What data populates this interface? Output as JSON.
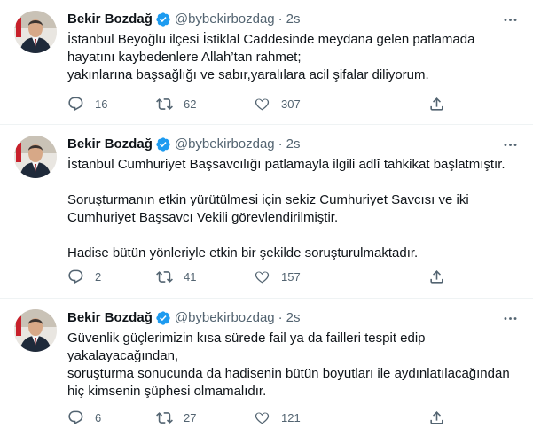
{
  "colors": {
    "text_primary": "#0f1419",
    "text_secondary": "#536471",
    "verified_blue": "#1d9bf0",
    "divider": "#eff3f4"
  },
  "tweets": [
    {
      "author": "Bekir Bozdağ",
      "handle": "@bybekirbozdag",
      "separator": "·",
      "time": "2s",
      "text": "İstanbul Beyoğlu ilçesi İstiklal Caddesinde meydana gelen patlamada\nhayatını kaybedenlere Allah’tan rahmet;\nyakınlarına başsağlığı ve sabır,yaralılara acil şifalar diliyorum.",
      "replies": "16",
      "retweets": "62",
      "likes": "307"
    },
    {
      "author": "Bekir Bozdağ",
      "handle": "@bybekirbozdag",
      "separator": "·",
      "time": "2s",
      "text": "İstanbul Cumhuriyet Başsavcılığı patlamayla ilgili adlî tahkikat başlatmıştır.\n\nSoruşturmanın etkin yürütülmesi için sekiz Cumhuriyet Savcısı ve iki\nCumhuriyet Başsavcı Vekili görevlendirilmiştir.\n\nHadise bütün yönleriyle etkin bir şekilde soruşturulmaktadır.",
      "replies": "2",
      "retweets": "41",
      "likes": "157"
    },
    {
      "author": "Bekir Bozdağ",
      "handle": "@bybekirbozdag",
      "separator": "·",
      "time": "2s",
      "text": "Güvenlik güçlerimizin kısa sürede fail ya da failleri tespit edip\nyakalayacağından,\nsoruşturma sonucunda da hadisenin bütün boyutları ile aydınlatılacağından\nhiç kimsenin şüphesi olmamalıdır.",
      "replies": "6",
      "retweets": "27",
      "likes": "121"
    }
  ]
}
